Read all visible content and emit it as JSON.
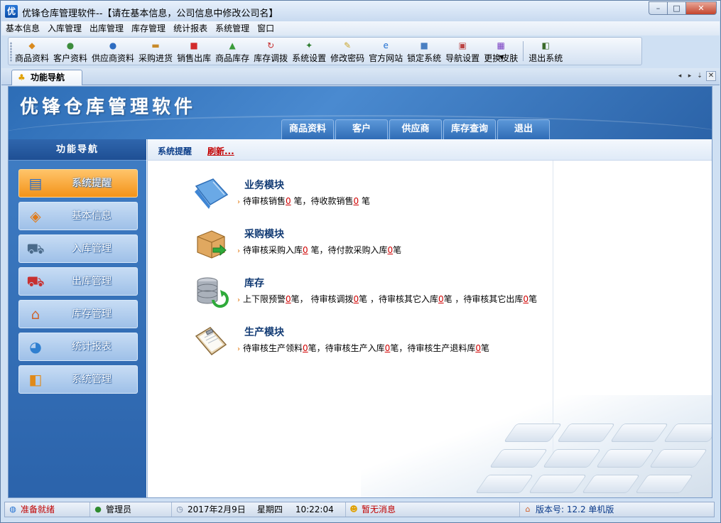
{
  "window": {
    "app_icon": "优",
    "title": "优锋仓库管理软件--【请在基本信息，公司信息中修改公司名】",
    "controls": {
      "minimize": "–",
      "maximize": "□",
      "close": "✕"
    }
  },
  "menu": [
    "基本信息",
    "入库管理",
    "出库管理",
    "库存管理",
    "统计报表",
    "系统管理",
    "窗口"
  ],
  "toolbar": [
    {
      "label": "商品资料",
      "icon": "package-icon",
      "glyph": "◆",
      "color": "#d98a1e"
    },
    {
      "label": "客户资料",
      "icon": "customer-icon",
      "glyph": "●",
      "color": "#3c8c3c"
    },
    {
      "label": "供应商资料",
      "icon": "supplier-icon",
      "glyph": "●",
      "color": "#2d6cc1"
    },
    {
      "label": "采购进货",
      "icon": "truck-icon",
      "glyph": "▬",
      "color": "#c88a2a"
    },
    {
      "label": "销售出库",
      "icon": "sales-icon",
      "glyph": "■",
      "color": "#d22b2b"
    },
    {
      "label": "商品库存",
      "icon": "stock-icon",
      "glyph": "▲",
      "color": "#3a9b3a"
    },
    {
      "label": "库存调拨",
      "icon": "transfer-icon",
      "glyph": "↻",
      "color": "#c62c2c"
    },
    {
      "label": "系统设置",
      "icon": "settings-icon",
      "glyph": "✦",
      "color": "#2f7d2f"
    },
    {
      "label": "修改密码",
      "icon": "key-icon",
      "glyph": "✎",
      "color": "#c9a42a"
    },
    {
      "label": "官方网站",
      "icon": "ie-icon",
      "glyph": "e",
      "color": "#1f6fd1"
    },
    {
      "label": "锁定系统",
      "icon": "lock-icon",
      "glyph": "■",
      "color": "#4a7fc2"
    },
    {
      "label": "导航设置",
      "icon": "nav-settings-icon",
      "glyph": "▣",
      "color": "#b44"
    },
    {
      "label": "更换皮肤",
      "icon": "skin-icon",
      "glyph": "▦",
      "color": "#7a3fc2"
    },
    {
      "label": "退出系统",
      "icon": "exit-icon",
      "glyph": "◧",
      "color": "#3a6a2a"
    }
  ],
  "tab": {
    "label": "功能导航",
    "icon": "nav-tab-icon"
  },
  "banner": {
    "title": "优锋仓库管理软件",
    "tabs": [
      "商品资料",
      "客户",
      "供应商",
      "库存查询",
      "退出"
    ]
  },
  "leftnav": {
    "header": "功能导航",
    "items": [
      {
        "label": "系统提醒",
        "icon": "reminder-icon",
        "glyph": "▤",
        "active": true
      },
      {
        "label": "基本信息",
        "icon": "basic-info-icon",
        "glyph": "◈"
      },
      {
        "label": "入库管理",
        "icon": "cart-in-icon",
        "glyph": "⛟"
      },
      {
        "label": "出库管理",
        "icon": "cart-out-icon",
        "glyph": "⛟"
      },
      {
        "label": "库存管理",
        "icon": "warehouse-icon",
        "glyph": "⌂"
      },
      {
        "label": "统计报表",
        "icon": "report-icon",
        "glyph": "◕"
      },
      {
        "label": "系统管理",
        "icon": "system-icon",
        "glyph": "◧"
      }
    ]
  },
  "crumb": {
    "title": "系统提醒",
    "refresh": "刷新..."
  },
  "modules": [
    {
      "title": "业务模块",
      "icon": "folder-icon",
      "parts": [
        [
          "text",
          "待审核销售"
        ],
        [
          "num",
          "0"
        ],
        [
          "text",
          " 笔，待收款销售"
        ],
        [
          "num",
          "0"
        ],
        [
          "text",
          " 笔"
        ]
      ]
    },
    {
      "title": "采购模块",
      "icon": "purchase-box-icon",
      "parts": [
        [
          "text",
          "待审核采购入库"
        ],
        [
          "num",
          "0"
        ],
        [
          "text",
          " 笔，待付款采购入库"
        ],
        [
          "num",
          "0"
        ],
        [
          "text",
          "笔"
        ]
      ]
    },
    {
      "title": "库存",
      "icon": "database-icon",
      "parts": [
        [
          "text",
          "上下限预警"
        ],
        [
          "num",
          "0"
        ],
        [
          "text",
          "笔，  待审核调拨"
        ],
        [
          "num",
          "0"
        ],
        [
          "text",
          "笔 ，待审核其它入库"
        ],
        [
          "num",
          "0"
        ],
        [
          "text",
          "笔 ，待审核其它出库"
        ],
        [
          "num",
          "0"
        ],
        [
          "text",
          "笔"
        ]
      ]
    },
    {
      "title": "生产模块",
      "icon": "clipboard-icon",
      "parts": [
        [
          "text",
          "待审核生产领料"
        ],
        [
          "num",
          "0"
        ],
        [
          "text",
          "笔，待审核生产入库"
        ],
        [
          "num",
          "0"
        ],
        [
          "text",
          "笔，待审核生产退料库"
        ],
        [
          "num",
          "0"
        ],
        [
          "text",
          "笔"
        ]
      ]
    }
  ],
  "status": {
    "ready": "准备就绪",
    "user": "管理员",
    "date": "2017年2月9日",
    "weekday": "星期四",
    "time": "10:22:04",
    "message": "暂无消息",
    "version": "版本号: 12.2 单机版"
  }
}
